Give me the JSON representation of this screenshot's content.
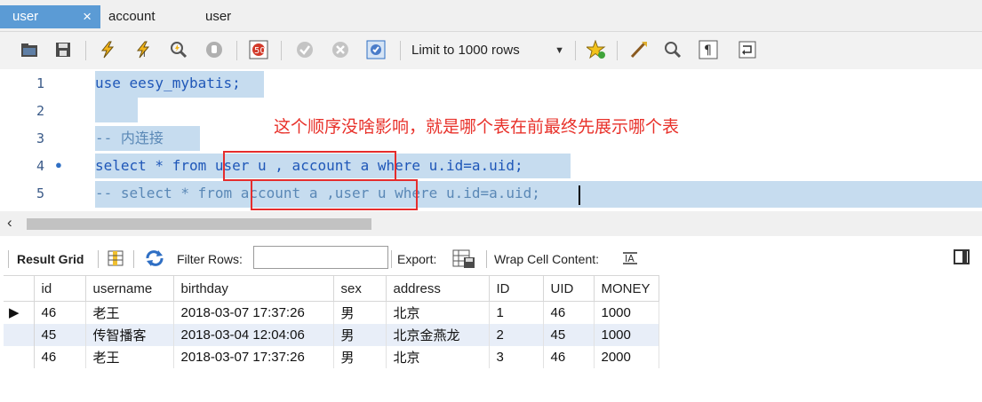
{
  "tabs": [
    {
      "label": "user",
      "active": true,
      "close": "×"
    },
    {
      "label": "account"
    },
    {
      "label": "user"
    }
  ],
  "toolbar": {
    "limit_value": "Limit to 1000 rows",
    "icons": [
      "open-folder-icon",
      "save-icon",
      "execute-icon",
      "execute-current-icon",
      "explain-icon",
      "stop-icon",
      "toggle-error-icon",
      "commit-icon",
      "rollback-icon",
      "autocommit-icon",
      "add-snippet-icon",
      "beautify-icon",
      "find-icon",
      "invisible-chars-icon",
      "wrap-icon"
    ]
  },
  "editor": {
    "lines": [
      {
        "num": "1",
        "text": "use eesy_mybatis;"
      },
      {
        "num": "2",
        "text": ""
      },
      {
        "num": "3",
        "text": "-- 内连接"
      },
      {
        "num": "4",
        "text": "select * from user u , account a where u.id=a.uid;",
        "marker": "●"
      },
      {
        "num": "5",
        "text": "-- select * from account a ,user u where u.id=a.uid;"
      }
    ],
    "note": "这个顺序没啥影响，就是哪个表在前最终先展示哪个表"
  },
  "result_toolbar": {
    "result_grid": "Result Grid",
    "filter_rows": "Filter Rows:",
    "filter_value": "",
    "export": "Export:",
    "wrap": "Wrap Cell Content:"
  },
  "grid": {
    "columns": [
      "id",
      "username",
      "birthday",
      "sex",
      "address",
      "ID",
      "UID",
      "MONEY"
    ],
    "rows": [
      [
        "46",
        "老王",
        "2018-03-07 17:37:26",
        "男",
        "北京",
        "1",
        "46",
        "1000"
      ],
      [
        "45",
        "传智播客",
        "2018-03-04 12:04:06",
        "男",
        "北京金燕龙",
        "2",
        "45",
        "1000"
      ],
      [
        "46",
        "老王",
        "2018-03-07 17:37:26",
        "男",
        "北京",
        "3",
        "46",
        "2000"
      ]
    ],
    "current_row_marker": "▶"
  }
}
